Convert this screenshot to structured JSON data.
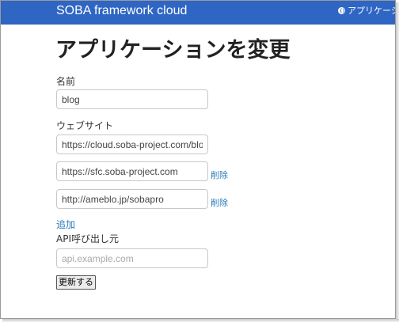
{
  "navbar": {
    "brand": "SOBA framework cloud",
    "link_label": "アプリケーシ"
  },
  "page": {
    "title": "アプリケーションを変更"
  },
  "form": {
    "name_label": "名前",
    "name_value": "blog",
    "website_label": "ウェブサイト",
    "websites": [
      {
        "value": "https://cloud.soba-project.com/blog"
      },
      {
        "value": "https://sfc.soba-project.com",
        "delete_label": "削除"
      },
      {
        "value": "http://ameblo.jp/sobapro",
        "delete_label": "削除"
      }
    ],
    "add_label": "追加",
    "api_label": "API呼び出し元",
    "api_placeholder": "api.example.com",
    "submit_label": "更新する"
  }
}
